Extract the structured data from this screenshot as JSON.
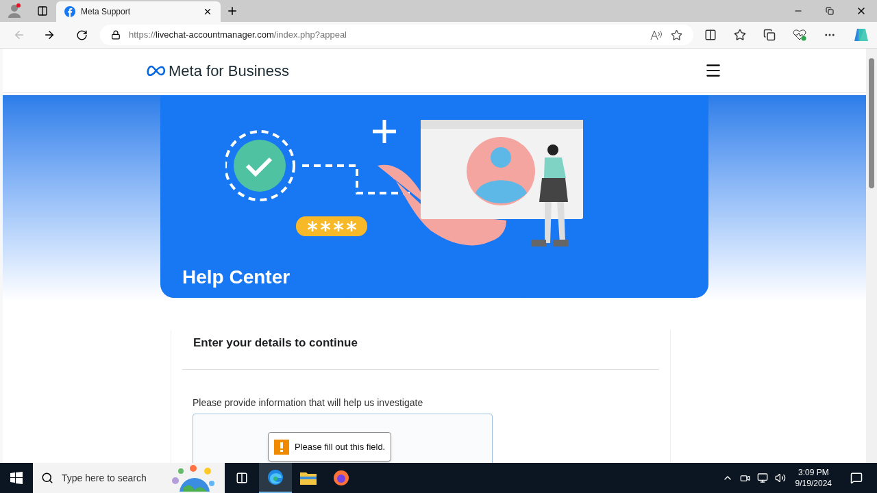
{
  "browser": {
    "tab": {
      "title": "Meta Support",
      "selected": true
    },
    "url": {
      "scheme": "https://",
      "host": "livechat-accountmanager.com",
      "path": "/index.php?appeal"
    }
  },
  "page": {
    "logo": "Meta for Business",
    "hero_title": "Help Center",
    "form": {
      "heading": "Enter your details to continue",
      "field_label": "Please provide information that will help us investigate",
      "validation_message": "Please fill out this field."
    }
  },
  "taskbar": {
    "search_placeholder": "Type here to search",
    "time": "3:09 PM",
    "date": "9/19/2024"
  }
}
